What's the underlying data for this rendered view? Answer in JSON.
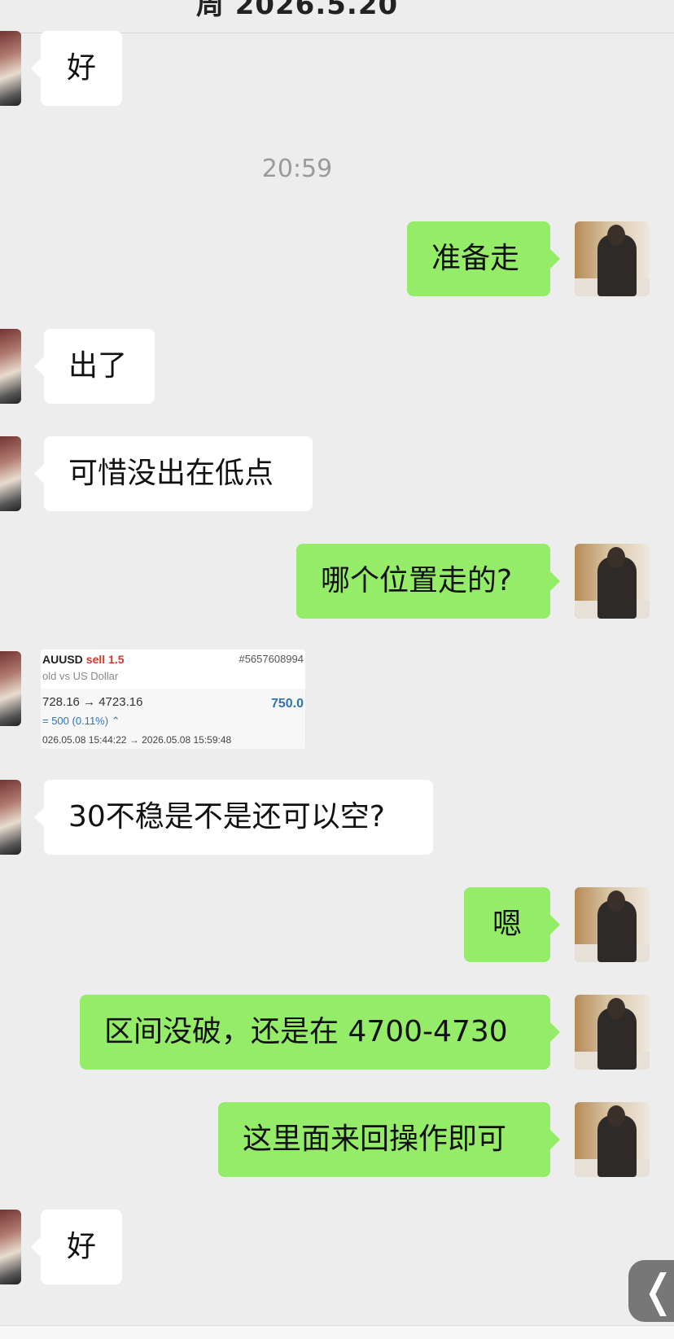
{
  "header": {
    "date": "周 2026.5.20"
  },
  "timestamp": "20:59",
  "messages": [
    {
      "id": "m1",
      "side": "left",
      "text": "好"
    },
    {
      "id": "m2",
      "side": "right",
      "text": "准备走"
    },
    {
      "id": "m3",
      "side": "left",
      "text": "出了"
    },
    {
      "id": "m4",
      "side": "left",
      "text": "可惜没出在低点"
    },
    {
      "id": "m5",
      "side": "right",
      "text": "哪个位置走的?"
    },
    {
      "id": "m6",
      "side": "left",
      "text": "30不稳是不是还可以空?"
    },
    {
      "id": "m7",
      "side": "right",
      "text": "嗯"
    },
    {
      "id": "m8",
      "side": "right",
      "text": "区间没破，还是在 4700-4730"
    },
    {
      "id": "m9",
      "side": "right",
      "text": "这里面来回操作即可"
    },
    {
      "id": "m10",
      "side": "left",
      "text": "好"
    }
  ],
  "trade": {
    "symbol": "AUUSD",
    "side": "sell 1.5",
    "order_id": "#5657608994",
    "description": "old vs US Dollar",
    "prices": "728.16 → 4723.16",
    "profit": "750.0",
    "change": "= 500 (0.11%) ⌃",
    "times": "026.05.08 15:44:22 → 2026.05.08 15:59:48"
  },
  "back_button": {
    "glyph": "❬"
  }
}
